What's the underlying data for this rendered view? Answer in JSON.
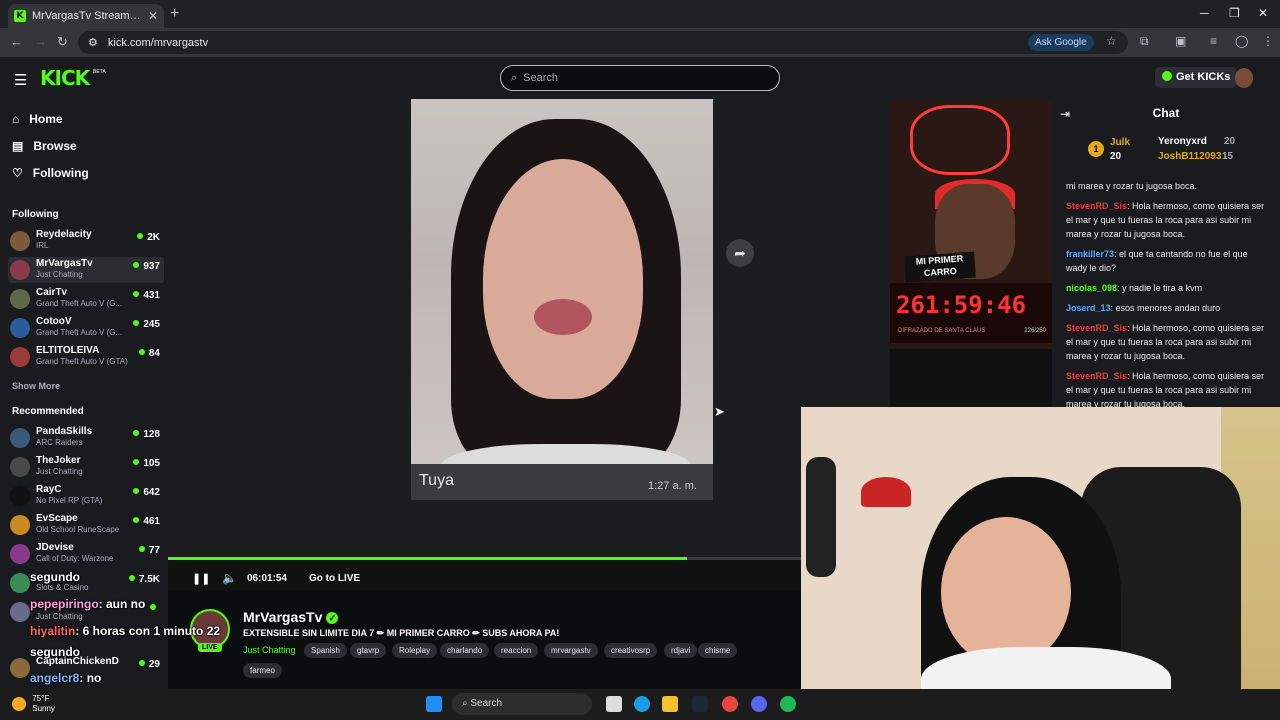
{
  "browser": {
    "tab_title": "MrVargasTv Stream - Watch Live",
    "new_tab": "+",
    "url": "kick.com/mrvargastv",
    "ask_google": "Ask Google"
  },
  "header": {
    "logo": "KICK",
    "beta": "BETA",
    "search_placeholder": "Search",
    "get_kicks": "Get KICKs"
  },
  "sidebar": {
    "nav": [
      {
        "label": "Home",
        "icon": "home-icon"
      },
      {
        "label": "Browse",
        "icon": "browse-icon"
      },
      {
        "label": "Following",
        "icon": "heart-icon"
      }
    ],
    "following_title": "Following",
    "following": [
      {
        "name": "Reydelacity",
        "category": "IRL",
        "viewers": "2K"
      },
      {
        "name": "MrVargasTv",
        "category": "Just Chatting",
        "viewers": "937"
      },
      {
        "name": "CairTv",
        "category": "Grand Theft Auto V (G...",
        "viewers": "431"
      },
      {
        "name": "CotooV",
        "category": "Grand Theft Auto V (G...",
        "viewers": "245"
      },
      {
        "name": "ELTITOLEIVA",
        "category": "Grand Theft Auto V (GTA)",
        "viewers": "84"
      }
    ],
    "show_more": "Show More",
    "recommended_title": "Recommended",
    "recommended": [
      {
        "name": "PandaSkills",
        "category": "ARC Raiders",
        "viewers": "128"
      },
      {
        "name": "TheJoker",
        "category": "Just Chatting",
        "viewers": "105"
      },
      {
        "name": "RayC",
        "category": "No Pixel RP (GTA)",
        "viewers": "642"
      },
      {
        "name": "EvScape",
        "category": "Old School RuneScape",
        "viewers": "461"
      },
      {
        "name": "JDevise",
        "category": "Call of Duty: Warzone",
        "viewers": "77"
      },
      {
        "name": "",
        "category": "Slots & Casino",
        "viewers": "7.5K"
      },
      {
        "name": "",
        "category": "Just Chatting",
        "viewers": ""
      },
      {
        "name": "CaptainChickenD",
        "category": "",
        "viewers": "29"
      }
    ]
  },
  "video": {
    "message_sender": "Tuya",
    "message_time": "1:27 a. m.",
    "overlay_banner": "MI PRIMER CARRO",
    "timer": "261:59:46",
    "timer_caption": "DIFRAZADO DE SANTA CLAUS",
    "timer_count": "226/250",
    "progress": 0.82,
    "elapsed": "06:01:54",
    "go_live": "Go to LIVE"
  },
  "chat": {
    "title": "Chat",
    "leaderboard": [
      {
        "rank": "1",
        "name": "Julk",
        "value": "20",
        "color": "#e3a718"
      },
      {
        "name": "Yeronyxrd",
        "value": "20",
        "color": "#ffffff"
      },
      {
        "name": "JoshB112093",
        "value": "15",
        "color": "#e3a718"
      }
    ],
    "messages": [
      {
        "user": "",
        "color": "#e9e9e9",
        "text": "mi marea y rozar tu jugosa boca."
      },
      {
        "user": "StevenRD_Sis",
        "color": "#e23b3b",
        "text": ": Hola hermoso, como quisiera ser el mar y que tu fueras la roca para asi subir mi marea y rozar tu jugosa boca."
      },
      {
        "user": "frankiller73",
        "color": "#5aa9ff",
        "text": ": el que ta cantando no fue el que wady le dio?"
      },
      {
        "user": "nicolas_098",
        "color": "#53fc18",
        "text": ": y nadie le tira a kvm"
      },
      {
        "user": "Joserd_13",
        "color": "#5aa9ff",
        "text": ": esos menores andan duro"
      },
      {
        "user": "StevenRD_Sis",
        "color": "#e23b3b",
        "text": ": Hola hermoso, como quisiera ser el mar y que tu fueras la roca para asi subir mi marea y rozar tu jugosa boca."
      },
      {
        "user": "StevenRD_Sis",
        "color": "#e23b3b",
        "text": ": Hola hermoso, como quisiera ser el mar y que tu fueras la roca para asi subir mi marea y rozar tu jugosa boca."
      }
    ]
  },
  "stream": {
    "name": "MrVargasTv",
    "live": "LIVE",
    "title": "EXTENSIBLE SIN LIMITE DIA 7 ✏ MI PRIMER CARRO ✏ SUBS AHORA PA!",
    "category": "Just Chatting",
    "tags": [
      "Spanish",
      "gtavrp",
      "Roleplay",
      "charlando",
      "reaccion",
      "mrvargastv",
      "creativosrp",
      "rdjavi",
      "chisme",
      "farmeo"
    ]
  },
  "overlay_chat": [
    {
      "user": "segundo",
      "text": "",
      "color": "#ffffff"
    },
    {
      "user": "pepepiringo",
      "text": ": aun no",
      "color": "#ff9ee6"
    },
    {
      "user": "hiyalitin",
      "text": ": 6 horas con 1 minuto 22",
      "color": "#ff6666"
    },
    {
      "user": "segundo",
      "text": "",
      "color": "#ffffff"
    },
    {
      "user": "angelcr8",
      "text": ": no",
      "color": "#8fb3ff"
    }
  ],
  "taskbar": {
    "temp": "75°F",
    "condition": "Sunny",
    "search": "Search"
  }
}
